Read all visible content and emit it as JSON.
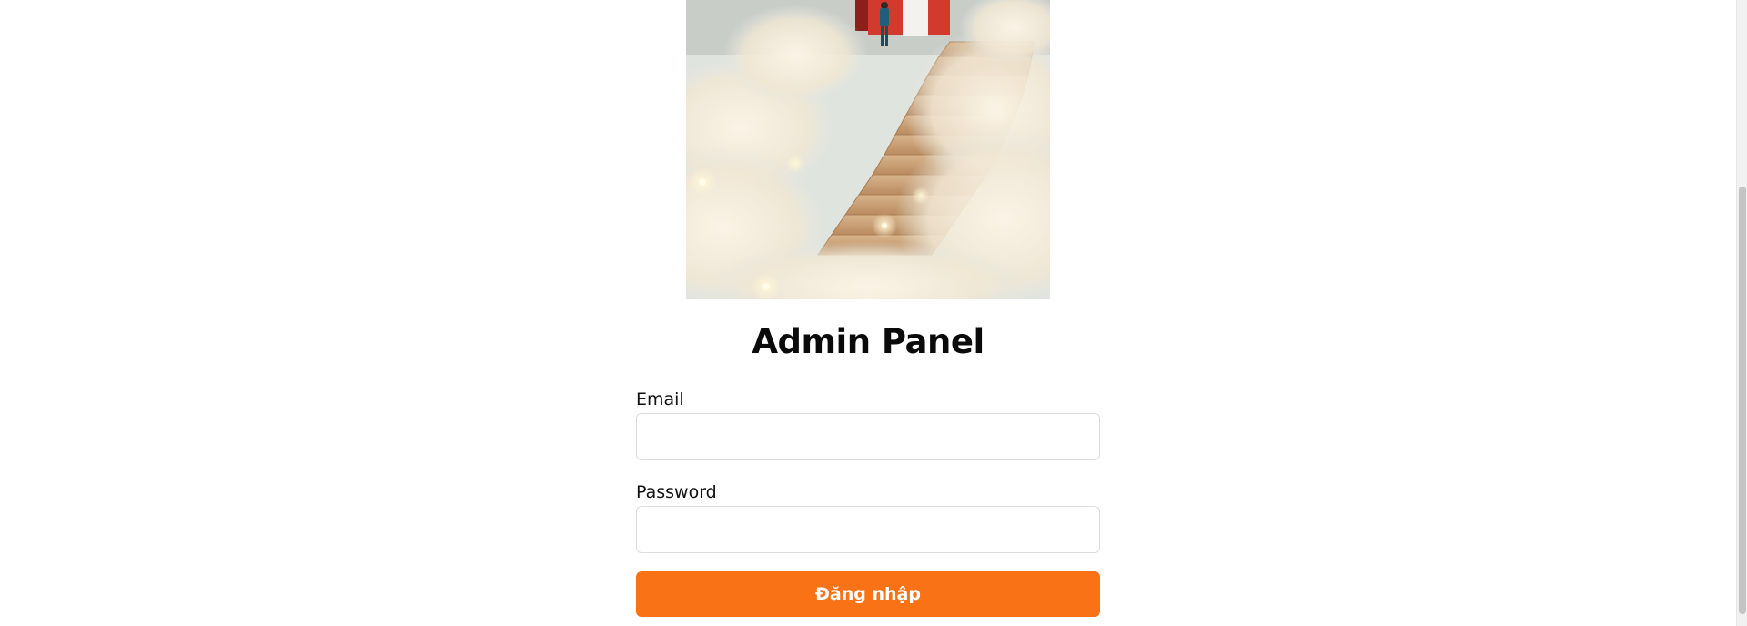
{
  "login": {
    "title": "Admin Panel",
    "email_label": "Email",
    "email_value": "",
    "password_label": "Password",
    "password_value": "",
    "submit_label": "Đăng nhập"
  },
  "hero_image": {
    "subject": "wooden-staircase-in-clouds",
    "accent": "#f97316"
  },
  "scrollbar": {
    "position_fraction": 0.3
  }
}
